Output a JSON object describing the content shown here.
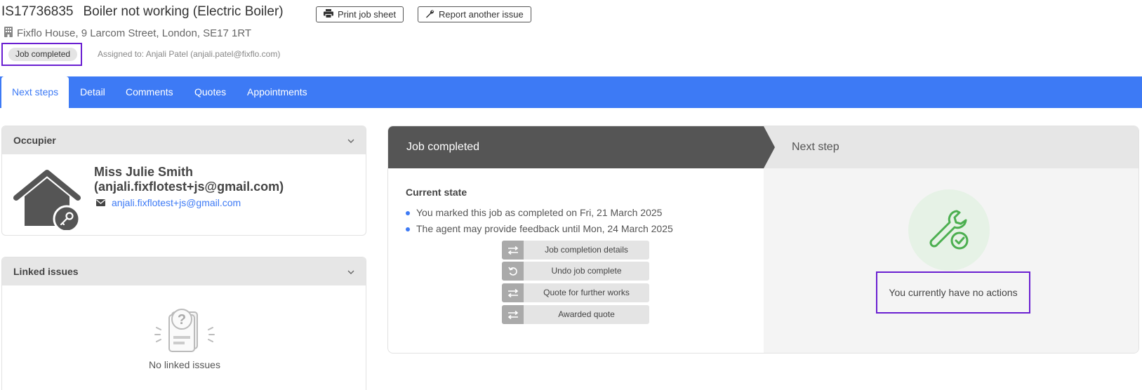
{
  "header": {
    "job_id": "IS17736835",
    "job_title": "Boiler not working (Electric Boiler)",
    "print_label": "Print job sheet",
    "report_label": "Report another issue",
    "address": "Fixflo House, 9 Larcom Street, London, SE17 1RT",
    "status": "Job completed",
    "assigned": "Assigned to: Anjali Patel (anjali.patel@fixflo.com)"
  },
  "tabs": [
    "Next steps",
    "Detail",
    "Comments",
    "Quotes",
    "Appointments"
  ],
  "occupier": {
    "title": "Occupier",
    "name": "Miss Julie Smith (anjali.fixflotest+js@gmail.com)",
    "email": "anjali.fixflotest+js@gmail.com"
  },
  "linked": {
    "title": "Linked issues",
    "empty_text": "No linked issues"
  },
  "progress": {
    "current_step": "Job completed",
    "next_step": "Next step",
    "current_state_title": "Current state",
    "state_items": [
      "You marked this job as completed on Fri, 21 March 2025",
      "The agent may provide feedback until Mon, 24 March 2025"
    ],
    "actions": [
      {
        "label": "Job completion details",
        "icon": "swap-icon"
      },
      {
        "label": "Undo job complete",
        "icon": "undo-icon"
      },
      {
        "label": "Quote for further works",
        "icon": "swap-icon"
      },
      {
        "label": "Awarded quote",
        "icon": "swap-icon"
      }
    ],
    "no_actions_text": "You currently have no actions"
  },
  "colors": {
    "brand_blue": "#3d7af5",
    "highlight_purple": "#6a1fd1",
    "success_green": "#4caf50"
  }
}
